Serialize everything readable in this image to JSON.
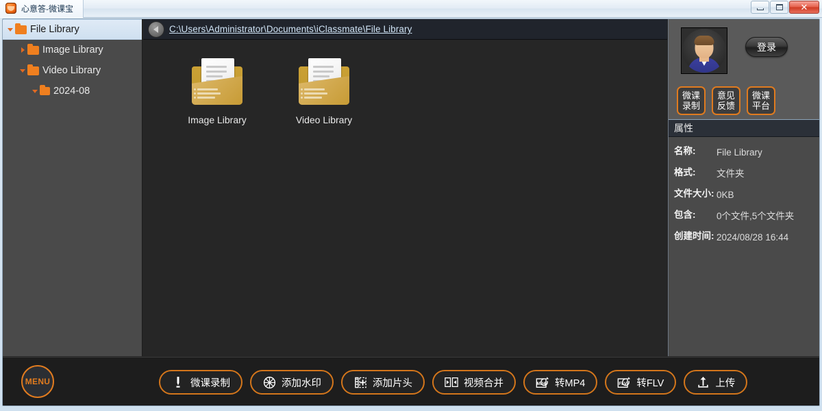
{
  "window": {
    "title": "心意答-微课宝",
    "app_icon": "app-logo-icon",
    "minimize_label": "Minimize",
    "maximize_label": "Maximize",
    "close_label": "✕"
  },
  "sidebar": {
    "items": [
      {
        "label": "File Library",
        "expander": "down",
        "depth": 0,
        "selected": true
      },
      {
        "label": "Image Library",
        "expander": "right",
        "depth": 1,
        "selected": false
      },
      {
        "label": "Video Library",
        "expander": "down",
        "depth": 1,
        "selected": false
      },
      {
        "label": "2024-08",
        "expander": "down",
        "depth": 2,
        "selected": false
      }
    ]
  },
  "pathbar": {
    "back_icon": "back-arrow-icon",
    "path": "C:\\Users\\Administrator\\Documents\\iClassmate\\File Library"
  },
  "content": {
    "files": [
      {
        "label": "Image Library",
        "icon": "folder-document-icon"
      },
      {
        "label": "Video Library",
        "icon": "folder-document-icon"
      }
    ]
  },
  "account": {
    "avatar_icon": "user-avatar-icon",
    "login_label": "登录",
    "buttons": [
      {
        "line1": "微课",
        "line2": "录制"
      },
      {
        "line1": "意见",
        "line2": "反馈"
      },
      {
        "line1": "微课",
        "line2": "平台"
      }
    ]
  },
  "properties": {
    "header": "属性",
    "rows": [
      {
        "key": "名称:",
        "value": "File Library"
      },
      {
        "key": "格式:",
        "value": "文件夹"
      },
      {
        "key": "文件大小:",
        "value": "0KB"
      },
      {
        "key": "包含:",
        "value": "0个文件,5个文件夹"
      },
      {
        "key": "创建时间:",
        "value": "2024/08/28  16:44"
      }
    ]
  },
  "toolbar": {
    "menu_label": "MENU",
    "buttons": [
      {
        "label": "微课录制",
        "icon": "record-pen-icon"
      },
      {
        "label": "添加水印",
        "icon": "watermark-wheel-icon"
      },
      {
        "label": "添加片头",
        "icon": "add-intro-icon"
      },
      {
        "label": "视频合并",
        "icon": "merge-video-icon"
      },
      {
        "label": "转MP4",
        "icon": "convert-mp4-icon"
      },
      {
        "label": "转FLV",
        "icon": "convert-flv-icon"
      },
      {
        "label": "上传",
        "icon": "upload-icon"
      }
    ]
  },
  "colors": {
    "accent_orange": "#e07b1f",
    "sidebar_bg": "#4a4a4a",
    "content_bg": "#262626",
    "toolbar_bg": "#1d1d1d",
    "folder_orange": "#ef7f1f"
  }
}
